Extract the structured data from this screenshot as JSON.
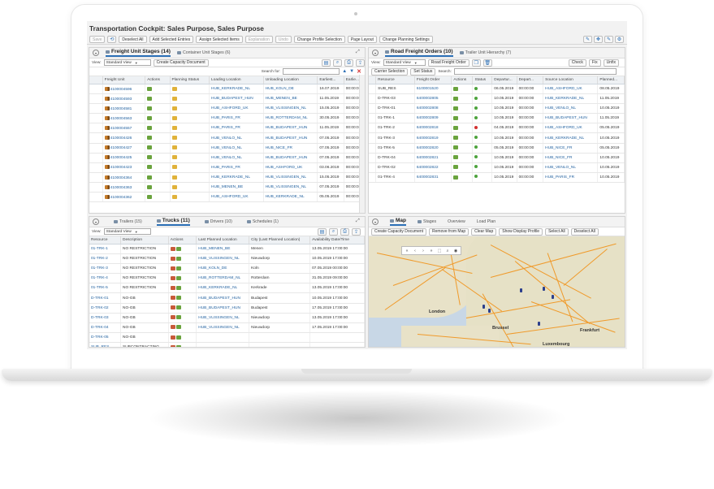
{
  "app": {
    "title": "Transportation Cockpit: Sales Purpose, Sales Purpose"
  },
  "toolbar": {
    "buttons": [
      "Save",
      "Deselect All",
      "Add Selected Entries",
      "Assign Selected Items",
      "Explanation",
      "Undo",
      "Change Profile Selection",
      "Page Layout",
      "Change Planning Settings"
    ],
    "disabled": [
      "Save",
      "Explanation",
      "Undo"
    ]
  },
  "stages_pane": {
    "tabs": [
      {
        "label": "Freight Unit Stages (14)",
        "active": true
      },
      {
        "label": "Container Unit Stages (6)",
        "active": false
      }
    ],
    "view_label": "View:",
    "view_value": "Standard View",
    "capacity_button": "Create Capacity Document",
    "search_label": "Search for:",
    "columns": [
      "Freight Unit",
      "Actions",
      "Planning Status",
      "Loading Location",
      "Unloading Location",
      "Earliest...",
      "Earlie..."
    ],
    "rows": [
      [
        "4100004596",
        "HUB_KERKRADE_NL",
        "HUB_KOLN_DE",
        "16.07.2019",
        "00:00:00"
      ],
      [
        "4100004593",
        "HUB_BUDAPEST_HUN",
        "HUB_MENEN_BE",
        "11.05.2019",
        "00:00:00"
      ],
      [
        "4100004581",
        "HUB_ASHFORD_UK",
        "HUB_VLISSINGEN_NL",
        "15.05.2019",
        "00:00:00"
      ],
      [
        "4100004563",
        "HUB_PARIS_FR",
        "HUB_ROTTERDAM_NL",
        "30.05.2019",
        "00:00:00"
      ],
      [
        "4100004557",
        "HUB_PARIS_FR",
        "HUB_BUDAPEST_HUN",
        "11.05.2019",
        "00:00:00"
      ],
      [
        "4100004426",
        "HUB_VENLO_NL",
        "HUB_BUDAPEST_HUN",
        "07.05.2019",
        "00:00:00"
      ],
      [
        "4100004427",
        "HUB_VENLO_NL",
        "HUB_NICE_FR",
        "07.05.2019",
        "00:00:00"
      ],
      [
        "4100004425",
        "HUB_VENLO_NL",
        "HUB_BUDAPEST_HUN",
        "07.05.2019",
        "00:00:00"
      ],
      [
        "4100004423",
        "HUB_PARIS_FR",
        "HUB_ASHFORD_UK",
        "03.06.2019",
        "00:00:00"
      ],
      [
        "4100004364",
        "HUB_KERKRADE_NL",
        "HUB_VLISSINGEN_NL",
        "15.05.2019",
        "00:00:00"
      ],
      [
        "4100004363",
        "HUB_MENEN_BE",
        "HUB_VLISSINGEN_NL",
        "07.05.2019",
        "00:00:00"
      ],
      [
        "4100004362",
        "HUB_ASHFORD_UK",
        "HUB_KERKRADE_NL",
        "05.05.2019",
        "00:00:00"
      ]
    ]
  },
  "orders_pane": {
    "tabs": [
      {
        "label": "Road Freight Orders (10)",
        "active": true
      },
      {
        "label": "Trailer Unit Hierarchy (7)",
        "active": false
      }
    ],
    "view_value": "Standard View",
    "order_button": "Road Freight Order",
    "buttons": [
      "Check",
      "Fix",
      "Unfix"
    ],
    "carrier_button": "Carrier Selection",
    "status_button": "Set Status",
    "search_label": "Search:",
    "columns": [
      "Resource",
      "Freight Order",
      "Actions",
      "Status",
      "Departur...",
      "Depart...",
      "Source Location",
      "Planned..."
    ],
    "rows": [
      [
        "SUB_RES",
        "6100001520",
        "green",
        "06.05.2019",
        "00:00:00",
        "HUB_ASHFORD_UK",
        "08.05.2019"
      ],
      [
        "D-TRK-03",
        "6400002805",
        "green",
        "10.05.2019",
        "00:00:00",
        "HUB_KERKRADE_NL",
        "11.05.2019"
      ],
      [
        "D-TRK-01",
        "6400002808",
        "green",
        "10.05.2019",
        "00:00:00",
        "HUB_VENLO_NL",
        "10.05.2019"
      ],
      [
        "01-TRK-1",
        "6400002809",
        "green",
        "10.05.2019",
        "00:00:00",
        "HUB_BUDAPEST_HUN",
        "11.05.2019"
      ],
      [
        "01-TRK-2",
        "6400002818",
        "red",
        "04.05.2019",
        "00:00:00",
        "HUB_ASHFORD_UK",
        "05.05.2019"
      ],
      [
        "01-TRK-3",
        "6400002819",
        "green",
        "10.05.2019",
        "00:00:00",
        "HUB_KERKRADE_NL",
        "10.05.2019"
      ],
      [
        "01-TRK-5",
        "6400002820",
        "green",
        "05.05.2019",
        "00:00:00",
        "HUB_NICE_FR",
        "05.05.2019"
      ],
      [
        "D-TRK-04",
        "6400002821",
        "green",
        "10.05.2019",
        "00:00:00",
        "HUB_NICE_FR",
        "10.05.2019"
      ],
      [
        "D-TRK-02",
        "6400002822",
        "green",
        "10.05.2019",
        "00:00:00",
        "HUB_VENLO_NL",
        "10.05.2019"
      ],
      [
        "01-TRK-4",
        "6400002831",
        "green",
        "10.05.2019",
        "00:00:00",
        "HUB_PARIS_FR",
        "10.05.2019"
      ]
    ]
  },
  "trucks_pane": {
    "tabs": [
      {
        "label": "Trailers (15)",
        "active": false
      },
      {
        "label": "Trucks (11)",
        "active": true
      },
      {
        "label": "Drivers (10)",
        "active": false
      },
      {
        "label": "Schedules (1)",
        "active": false
      }
    ],
    "view_value": "Standard View",
    "columns": [
      "Resource",
      "Description",
      "Actions",
      "Last Planned Location",
      "City (Last Planned Location)",
      "Availability Date/Time"
    ],
    "rows": [
      [
        "01-TRK-1",
        "NO RESTRICTION",
        "HUB_MENEN_BE",
        "Menen",
        "13.05.2019 17:00:00"
      ],
      [
        "01-TRK-2",
        "NO RESTRICTION",
        "HUB_VLISSINGEN_NL",
        "Nieuwdorp",
        "10.05.2019 17:00:00"
      ],
      [
        "01-TRK-3",
        "NO RESTRICTION",
        "HUB_KOLN_DE",
        "Koln",
        "07.05.2019 00:00:00"
      ],
      [
        "01-TRK-4",
        "NO RESTRICTION",
        "HUB_ROTTERDAM_NL",
        "Rotterdam",
        "31.05.2019 09:00:00"
      ],
      [
        "01-TRK-5",
        "NO RESTRICTION",
        "HUB_KERKRADE_NL",
        "Kerkrade",
        "13.05.2019 17:00:00"
      ],
      [
        "D-TRK-01",
        "NO-GB",
        "HUB_BUDAPEST_HUN",
        "Budapest",
        "10.05.2019 17:00:00"
      ],
      [
        "D-TRK-02",
        "NO-GB",
        "HUB_BUDAPEST_HUN",
        "Budapest",
        "17.05.2019 17:00:00"
      ],
      [
        "D-TRK-03",
        "NO-GB",
        "HUB_VLISSINGEN_NL",
        "Nieuwdorp",
        "13.05.2019 17:00:00"
      ],
      [
        "D-TRK-04",
        "NO-GB",
        "HUB_VLISSINGEN_NL",
        "Nieuwdorp",
        "17.05.2019 17:00:00"
      ],
      [
        "D-TRK-05",
        "NO-GB",
        "",
        "",
        ""
      ],
      [
        "SUB_RES",
        "SUBCONTRACTING",
        "",
        "",
        ""
      ]
    ]
  },
  "map_pane": {
    "tabs": [
      {
        "label": "Map",
        "active": true
      },
      {
        "label": "Stages",
        "active": false
      },
      {
        "label": "Overview",
        "active": false
      },
      {
        "label": "Load Plan",
        "active": false
      }
    ],
    "buttons": [
      "Create Capacity Document",
      "Remove from Map",
      "Clear Map",
      "Show Display Profile",
      "Select All",
      "Deselect All"
    ],
    "cities": [
      "London",
      "Brussel",
      "Frankfurt",
      "Luxembourg"
    ]
  },
  "colors": {
    "accent": "#2a6eb5",
    "link": "#1f5f9e",
    "status_green": "#4da33d",
    "status_red": "#d33030",
    "road": "#f09a2a"
  }
}
